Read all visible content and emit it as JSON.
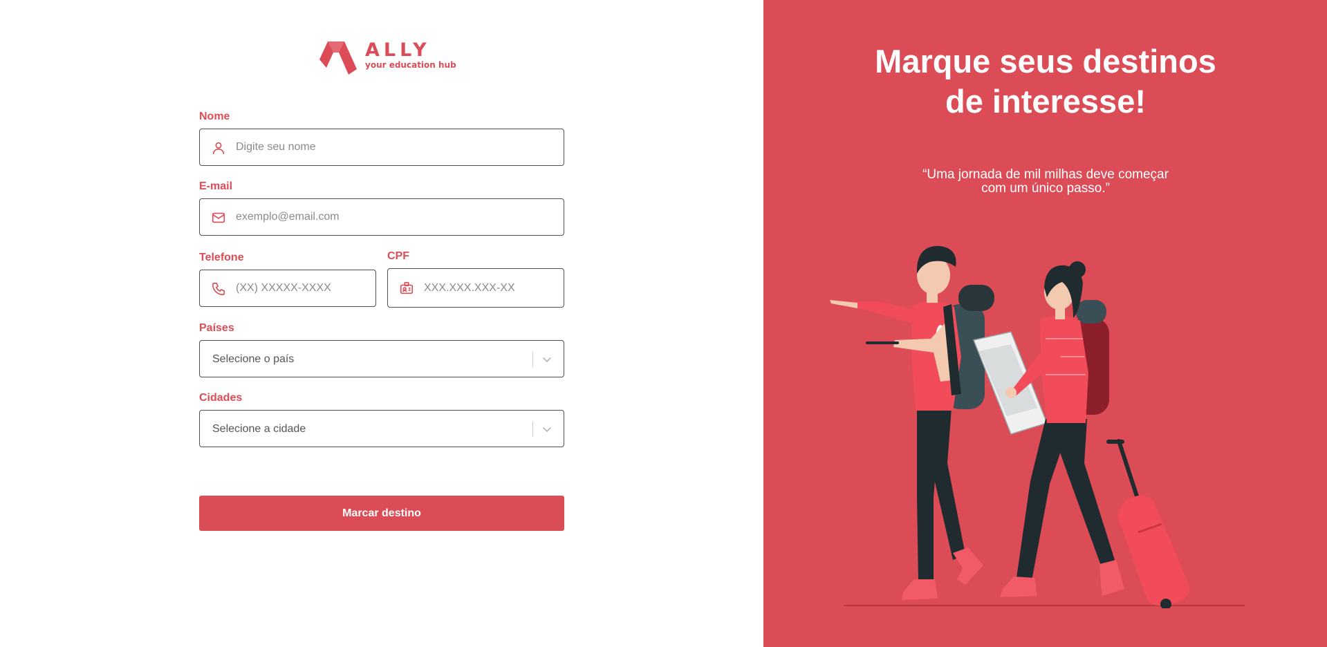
{
  "brand": {
    "name": "ALLY",
    "tagline": "your education hub",
    "color": "#dc4c57"
  },
  "form": {
    "name": {
      "label": "Nome",
      "placeholder": "Digite seu nome",
      "value": "",
      "icon": "user-icon"
    },
    "email": {
      "label": "E-mail",
      "placeholder": "exemplo@email.com",
      "value": "",
      "icon": "mail-icon"
    },
    "phone": {
      "label": "Telefone",
      "placeholder": "(XX) XXXXX-XXXX",
      "value": "",
      "icon": "phone-icon"
    },
    "cpf": {
      "label": "CPF",
      "placeholder": "XXX.XXX.XXX-XX",
      "value": "",
      "icon": "id-badge-icon"
    },
    "countries": {
      "label": "Países",
      "selected": "Selecione o país",
      "icon": "chevron-down-icon"
    },
    "cities": {
      "label": "Cidades",
      "selected": "Selecione a cidade",
      "icon": "chevron-down-icon"
    },
    "submit_label": "Marcar destino"
  },
  "panel": {
    "headline_line1": "Marque seus destinos",
    "headline_line2": "de interesse!",
    "quote_line1": "“Uma jornada de mil milhas deve começar",
    "quote_line2": "com um único passo.”",
    "illustration": "travelers-illustration",
    "background": "#dc4c57"
  }
}
